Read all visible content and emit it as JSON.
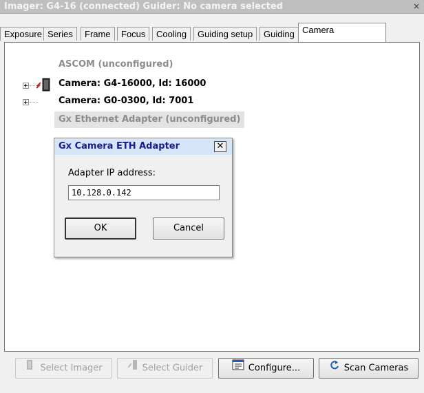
{
  "window": {
    "title": "Imager: G4-16 (connected) Guider: No camera selected",
    "close_glyph": "×"
  },
  "tabs": [
    {
      "label": "Exposure"
    },
    {
      "label": "Series"
    },
    {
      "label": "Frame"
    },
    {
      "label": "Focus"
    },
    {
      "label": "Cooling"
    },
    {
      "label": "Guiding setup"
    },
    {
      "label": "Guiding"
    },
    {
      "label": "Camera",
      "active": true
    }
  ],
  "tree": {
    "items": [
      {
        "label": "ASCOM (unconfigured)",
        "greyed": true,
        "expander": false
      },
      {
        "label": "Camera: G4-16000, Id: 16000",
        "greyed": false,
        "expander": true,
        "icon": "camera-imager-icon"
      },
      {
        "label": "Camera: G0-0300, Id: 7001",
        "greyed": false,
        "expander": true
      },
      {
        "label": "Gx Ethernet Adapter (unconfigured)",
        "greyed": true,
        "expander": false,
        "selected": true
      }
    ]
  },
  "dialog": {
    "title": "Gx Camera ETH Adapter",
    "close_glyph": "✕",
    "field_label": "Adapter IP address:",
    "ip_value": "10.128.0.142",
    "ok_label": "OK",
    "cancel_label": "Cancel"
  },
  "toolbar": {
    "select_imager_label": "Select Imager",
    "select_guider_label": "Select Guider",
    "configure_label": "Configure...",
    "scan_cameras_label": "Scan Cameras"
  },
  "colors": {
    "greyed_text": "#8c8c8c",
    "selected_bg": "#e3e3e3",
    "accent_blue": "#1f5fb0"
  }
}
